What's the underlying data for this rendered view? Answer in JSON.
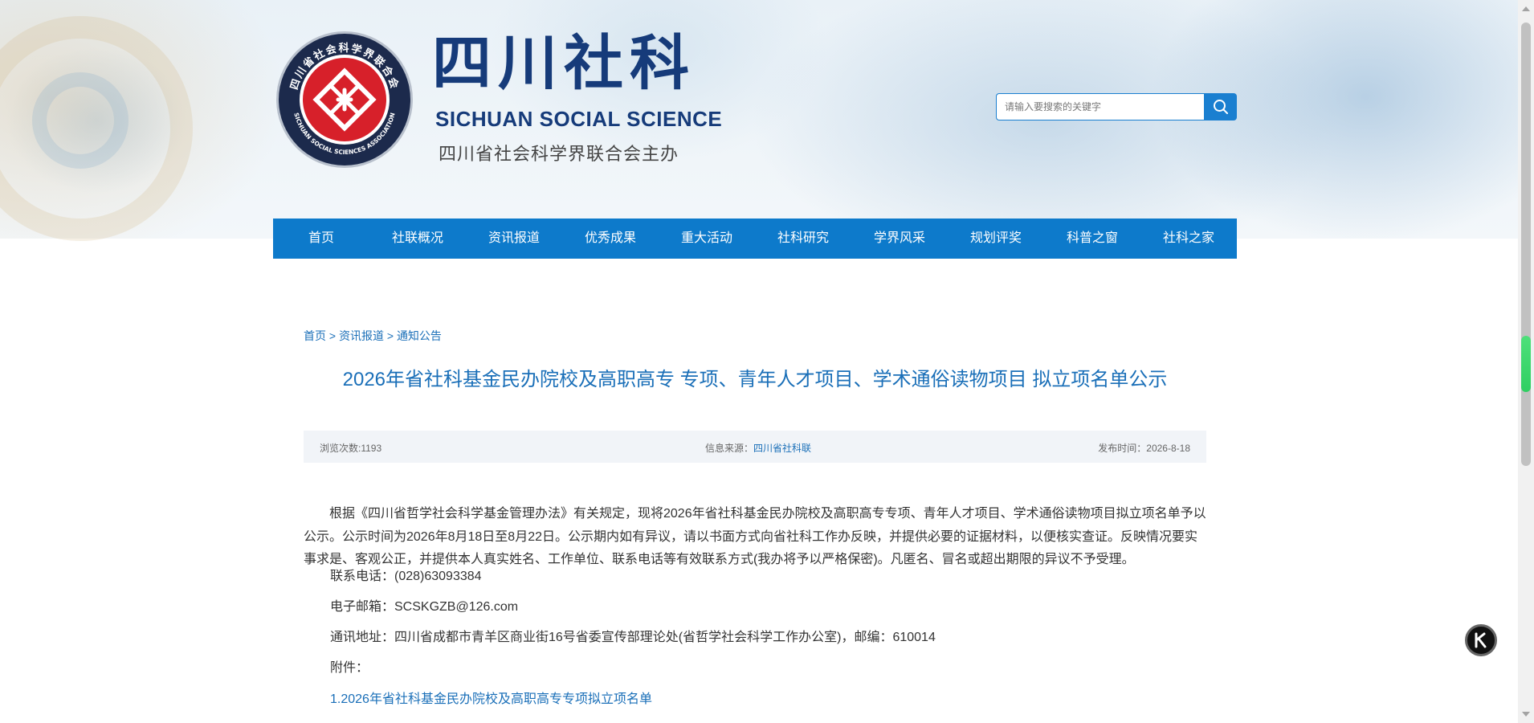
{
  "header": {
    "logo_cn": "四川社科",
    "logo_en": "SICHUAN SOCIAL SCIENCE",
    "logo_sub": "四川省社会科学界联合会主办",
    "seal_ring_text_top": "四川省社会科学界联合会",
    "seal_ring_text_bottom": "SICHUAN SOCIAL SCIENCES ASSOCIATION",
    "brand_color": "#163b7a",
    "seal_red": "#d7202a"
  },
  "search": {
    "placeholder": "请输入要搜索的关键字",
    "icon": "search-icon",
    "accent": "#1a7fd0"
  },
  "nav": {
    "background": "#0d7acb",
    "items": [
      {
        "label": "首页"
      },
      {
        "label": "社联概况"
      },
      {
        "label": "资讯报道"
      },
      {
        "label": "优秀成果"
      },
      {
        "label": "重大活动"
      },
      {
        "label": "社科研究"
      },
      {
        "label": "学界风采"
      },
      {
        "label": "规划评奖"
      },
      {
        "label": "科普之窗"
      },
      {
        "label": "社科之家"
      }
    ]
  },
  "breadcrumb": {
    "items": [
      "首页",
      "资讯报道",
      "通知公告"
    ],
    "separator": ">"
  },
  "article": {
    "title": "2026年省社科基金民办院校及高职高专 专项、青年人才项目、学术通俗读物项目 拟立项名单公示",
    "meta": {
      "views": "浏览次数:1193",
      "source_label": "信息来源：",
      "source_value": "四川省社科联",
      "date": "发布时间：2026-8-18"
    },
    "body": "根据《四川省哲学社会科学基金管理办法》有关规定，现将2026年省社科基金民办院校及高职高专专项、青年人才项目、学术通俗读物项目拟立项名单予以公示。公示时间为2026年8月18日至8月22日。公示期内如有异议，请以书面方式向省社科工作办反映，并提供必要的证据材料，以便核实查证。反映情况要实事求是、客观公正，并提供本人真实姓名、工作单位、联系电话等有效联系方式(我办将予以严格保密)。凡匿名、冒名或超出期限的异议不予受理。",
    "phone": "联系电话：(028)63093384",
    "email": "电子邮箱：SCSKGZB@126.com",
    "address": "通讯地址：四川省成都市青羊区商业街16号省委宣传部理论处(省哲学社会科学工作办公室)，邮编：610014",
    "attachment_label": "附件：",
    "attachments": [
      "1.2026年省社科基金民办院校及高职高专专项拟立项名单"
    ]
  },
  "floating_button": {
    "icon": "k-logo-icon"
  }
}
